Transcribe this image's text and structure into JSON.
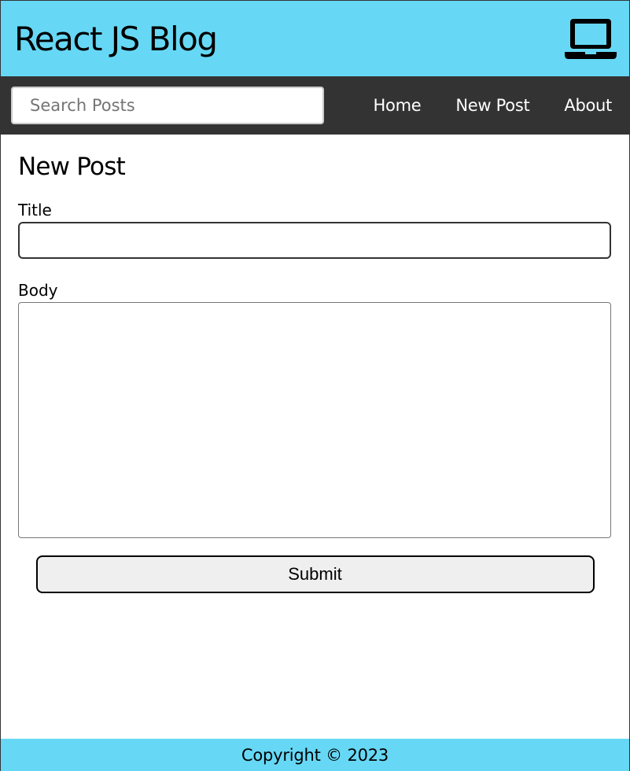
{
  "header": {
    "title": "React JS Blog",
    "icon": "laptop-icon"
  },
  "nav": {
    "search": {
      "placeholder": "Search Posts",
      "value": ""
    },
    "links": [
      {
        "label": "Home"
      },
      {
        "label": "New Post"
      },
      {
        "label": "About"
      }
    ]
  },
  "main": {
    "heading": "New Post",
    "form": {
      "title_label": "Title",
      "title_value": "",
      "body_label": "Body",
      "body_value": "",
      "submit_label": "Submit"
    }
  },
  "footer": {
    "text": "Copyright © 2023"
  },
  "colors": {
    "header_bg": "#66d8f5",
    "nav_bg": "#333333",
    "footer_bg": "#66d8f5"
  }
}
